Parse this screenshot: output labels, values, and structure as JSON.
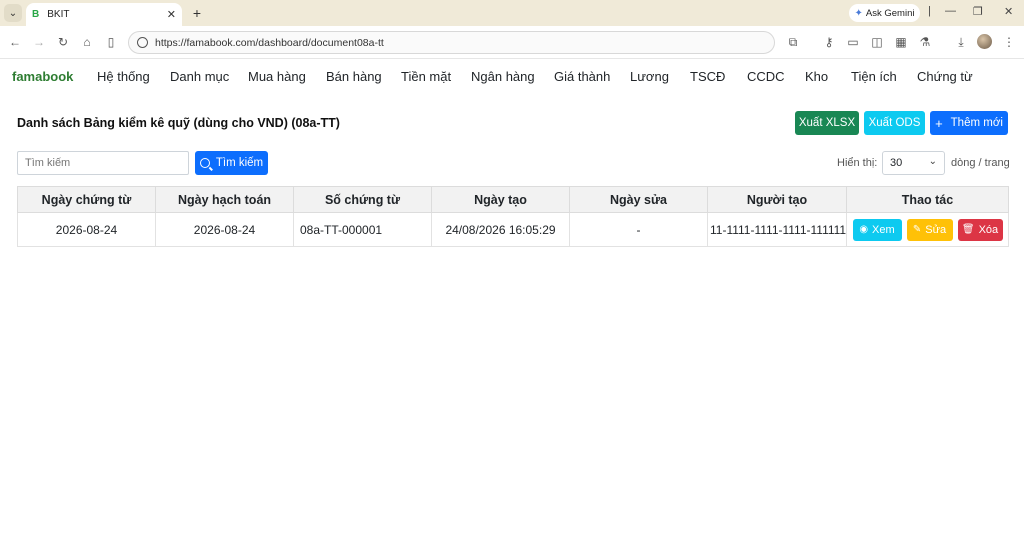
{
  "browser": {
    "tab_title": "BKIT",
    "tab_favicon": "B",
    "new_tab": "+",
    "ask_gemini": "Ask Gemini",
    "url": "https://famabook.com/dashboard/document08a-tt"
  },
  "app": {
    "brand": "famabook",
    "nav": [
      {
        "label": "Hệ thống"
      },
      {
        "label": "Danh mục"
      },
      {
        "label": "Mua hàng"
      },
      {
        "label": "Bán hàng"
      },
      {
        "label": "Tiền mặt"
      },
      {
        "label": "Ngân hàng"
      },
      {
        "label": "Giá thành"
      },
      {
        "label": "Lương"
      },
      {
        "label": "TSCĐ"
      },
      {
        "label": "CCDC"
      },
      {
        "label": "Kho"
      },
      {
        "label": "Tiện ích"
      },
      {
        "label": "Chứng từ"
      }
    ]
  },
  "page": {
    "title": "Danh sách Bảng kiểm kê quỹ (dùng cho VND) (08a-TT)",
    "export_xlsx": "Xuất XLSX",
    "export_ods": "Xuất ODS",
    "add_new": "Thêm mới",
    "search_placeholder": "Tìm kiếm",
    "search_button": "Tìm kiếm",
    "show_label": "Hiển thị:",
    "page_size": "30",
    "rows_label": "dòng / trang"
  },
  "table": {
    "columns": [
      "Ngày chứng từ",
      "Ngày hạch toán",
      "Số chứng từ",
      "Ngày tạo",
      "Ngày sửa",
      "Người tạo",
      "Thao tác"
    ],
    "rows": [
      {
        "doc_date": "2026-08-24",
        "posting_date": "2026-08-24",
        "doc_no": "08a-TT-000001",
        "created": "24/08/2026 16:05:29",
        "modified": "-",
        "creator": "11-1111-1111-1111-111111",
        "view": "Xem",
        "edit": "Sửa",
        "delete": "Xóa"
      }
    ]
  }
}
